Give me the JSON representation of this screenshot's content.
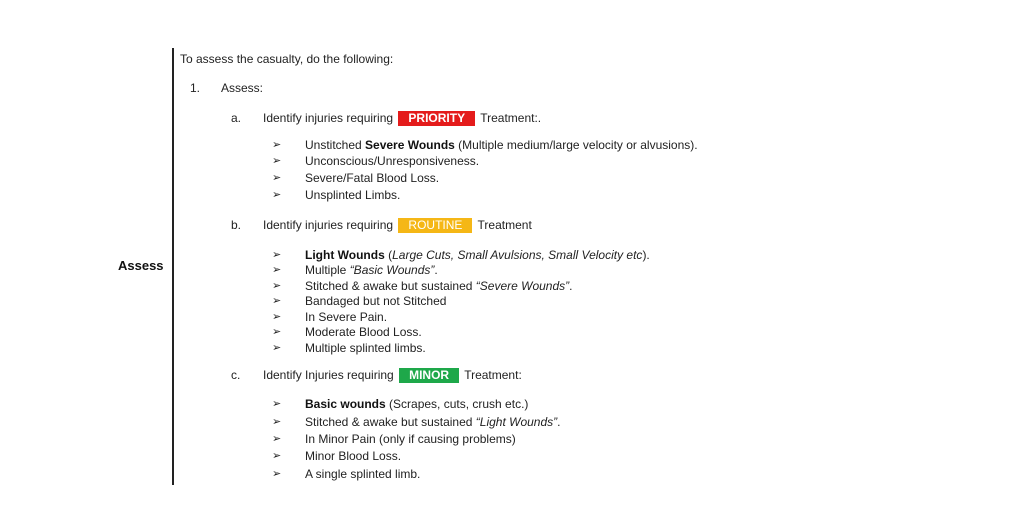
{
  "side_label": "Assess",
  "intro": "To assess the casualty, do the following:",
  "step": {
    "number": "1.",
    "label": "Assess:"
  },
  "sections": [
    {
      "letter": "a.",
      "prefix": "Identify injuries requiring",
      "badge": "PRIORITY",
      "badge_color": "#e41b1b",
      "suffix": "Treatment:.",
      "items": [
        {
          "bold": "Unstitched ",
          "bold2": "Severe Wounds",
          "rest": " (Multiple medium/large velocity or alvusions)."
        },
        {
          "text": "Unconscious/Unresponsiveness."
        },
        {
          "text": "Severe/Fatal Blood Loss."
        },
        {
          "text": "Unsplinted Limbs."
        }
      ]
    },
    {
      "letter": "b.",
      "prefix": "Identify injuries requiring",
      "badge": "ROUTINE",
      "badge_color": "#f5b716",
      "suffix": "Treatment",
      "items": [
        {
          "bold": "Light Wounds",
          "rest1": " (",
          "italic": "Large Cuts, Small Avulsions, Small Velocity etc",
          "rest2": ")."
        },
        {
          "text": "Multiple ",
          "italic": "“Basic Wounds”",
          "rest": "."
        },
        {
          "text": "Stitched & awake but sustained ",
          "italic": "“Severe Wounds”",
          "rest": "."
        },
        {
          "text": "Bandaged but not Stitched"
        },
        {
          "text": "In Severe Pain."
        },
        {
          "text": "Moderate Blood Loss."
        },
        {
          "text": "Multiple splinted limbs."
        }
      ]
    },
    {
      "letter": "c.",
      "prefix": "Identify Injuries requiring",
      "badge": "MINOR",
      "badge_color": "#1ea84a",
      "suffix": "Treatment:",
      "items": [
        {
          "bold": "Basic wounds",
          "rest": " (Scrapes, cuts, crush etc.)"
        },
        {
          "text": "Stitched & awake but sustained ",
          "italic": "“Light Wounds”",
          "rest": "."
        },
        {
          "text": "In Minor Pain (only if causing problems)"
        },
        {
          "text": "Minor Blood Loss."
        },
        {
          "text": "A single splinted limb."
        }
      ]
    }
  ],
  "bullet_glyph": "➢"
}
